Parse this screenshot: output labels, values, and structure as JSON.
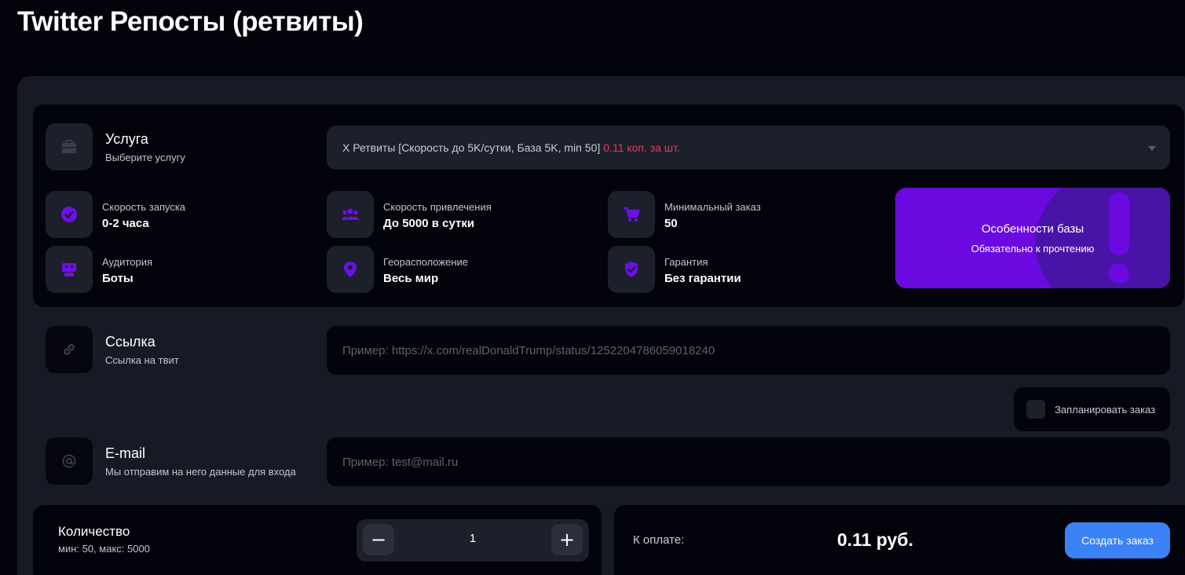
{
  "page": {
    "title": "Twitter Репосты (ретвиты)"
  },
  "service": {
    "title": "Услуга",
    "subtitle": "Выберите услугу",
    "selected": "X Ретвиты [Скорость до 5K/сутки, База 5K, min 50]",
    "price": "0.11 коп. за шт.",
    "icon": "briefcase-icon"
  },
  "stats": [
    {
      "label": "Скорость запуска",
      "value": "0-2 часа",
      "icon": "clock-check-icon"
    },
    {
      "label": "Скорость привлечения",
      "value": "До 5000 в сутки",
      "icon": "users-icon"
    },
    {
      "label": "Минимальный заказ",
      "value": "50",
      "icon": "cart-icon"
    },
    {
      "label": "Аудитория",
      "value": "Боты",
      "icon": "bot-icon"
    },
    {
      "label": "Георасположение",
      "value": "Весь мир",
      "icon": "location-pin-icon"
    },
    {
      "label": "Гарантия",
      "value": "Без гарантии",
      "icon": "shield-check-icon"
    }
  ],
  "promo": {
    "title": "Особенности базы",
    "subtitle": "Обязательно к прочтению",
    "icon": "exclamation-icon"
  },
  "link": {
    "title": "Ссылка",
    "subtitle": "Ссылка на твит",
    "placeholder": "Пример: https://x.com/realDonaldTrump/status/1252204786059018240",
    "value": "",
    "icon": "link-icon"
  },
  "schedule": {
    "label": "Запланировать заказ",
    "checked": false
  },
  "email": {
    "title": "E-mail",
    "subtitle": "Мы отправим на него данные для входа",
    "placeholder": "Пример: test@mail.ru",
    "value": "",
    "icon": "at-sign-icon"
  },
  "quantity": {
    "title": "Количество",
    "hint": "мин: 50, макс: 5000",
    "value": "1",
    "minus": "−",
    "plus": "+"
  },
  "payment": {
    "label": "К оплате:",
    "amount": "0.11 руб.",
    "button": "Создать заказ"
  },
  "colors": {
    "accent": "#6a0ae0",
    "price": "#e83a5a",
    "button": "#3b82f6",
    "icon": "#6d0fe6"
  }
}
